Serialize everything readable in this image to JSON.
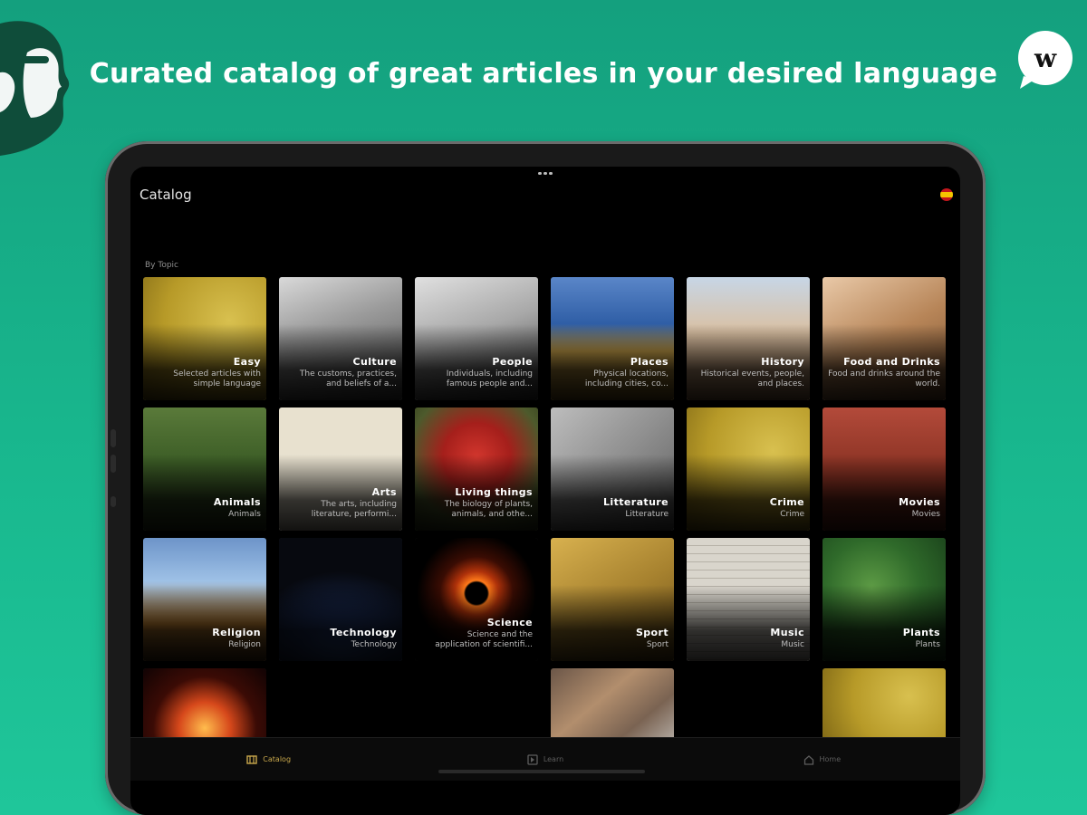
{
  "banner": {
    "headline": "Curated catalog of great articles in your desired language"
  },
  "logos": {
    "right_logo_letter": "w",
    "brand_color": "#0f4d3a"
  },
  "app": {
    "title": "Catalog",
    "section_label": "By Topic",
    "accent_color": "#c9a84c",
    "language_flag": "spain-flag-icon"
  },
  "topics": [
    {
      "title": "Easy",
      "desc": "Selected articles with simple language",
      "art": "headphones"
    },
    {
      "title": "Culture",
      "desc": "The customs, practices, and beliefs of a...",
      "art": "culture"
    },
    {
      "title": "People",
      "desc": "Individuals, including famous people and...",
      "art": "people"
    },
    {
      "title": "Places",
      "desc": "Physical locations, including cities, co...",
      "art": "places"
    },
    {
      "title": "History",
      "desc": "Historical events, people, and places.",
      "art": "history"
    },
    {
      "title": "Food and Drinks",
      "desc": "Food and drinks around the world.",
      "art": "food"
    },
    {
      "title": "Animals",
      "desc": "Animals",
      "art": "animals"
    },
    {
      "title": "Arts",
      "desc": "The arts, including literature, performi...",
      "art": "arts"
    },
    {
      "title": "Living things",
      "desc": "The biology of plants, animals, and othe...",
      "art": "living"
    },
    {
      "title": "Litterature",
      "desc": "Litterature",
      "art": "litt"
    },
    {
      "title": "Crime",
      "desc": "Crime",
      "art": "headphones"
    },
    {
      "title": "Movies",
      "desc": "Movies",
      "art": "movies"
    },
    {
      "title": "Religion",
      "desc": "Religion",
      "art": "religion"
    },
    {
      "title": "Technology",
      "desc": "Technology",
      "art": "tech"
    },
    {
      "title": "Science",
      "desc": "Science and the application of scientifi...",
      "art": "science"
    },
    {
      "title": "Sport",
      "desc": "Sport",
      "art": "sport"
    },
    {
      "title": "Music",
      "desc": "Music",
      "art": "music"
    },
    {
      "title": "Plants",
      "desc": "Plants",
      "art": "plants"
    }
  ],
  "partial_row": [
    "fireworks",
    "",
    "",
    "money",
    "",
    "headphones"
  ],
  "tabs": [
    {
      "label": "Catalog",
      "icon": "catalog-icon",
      "active": true
    },
    {
      "label": "Learn",
      "icon": "learn-icon",
      "active": false
    },
    {
      "label": "Home",
      "icon": "home-icon",
      "active": false
    }
  ]
}
